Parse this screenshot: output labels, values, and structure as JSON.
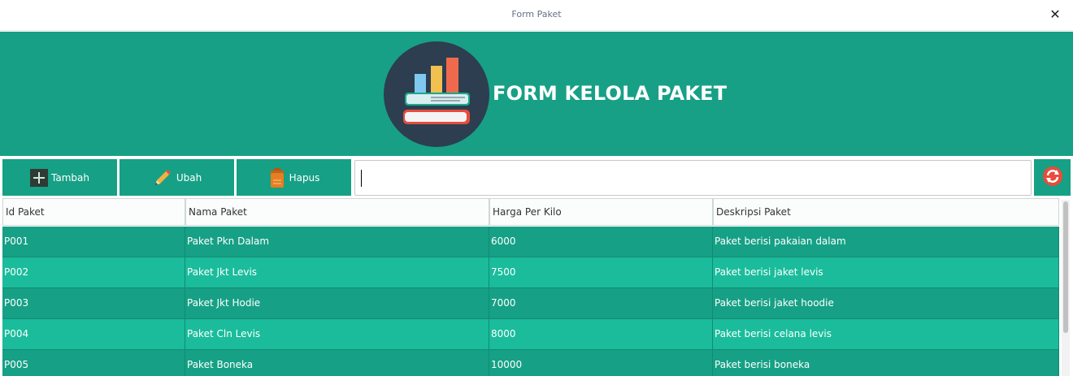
{
  "window": {
    "title": "Form Paket",
    "close_icon": "close-icon"
  },
  "banner": {
    "heading": "FORM KELOLA PAKET",
    "logo_icon": "books-chart-icon",
    "background": "#17a085"
  },
  "toolbar": {
    "tambah_label": "Tambah",
    "ubah_label": "Ubah",
    "hapus_label": "Hapus",
    "search_value": "",
    "search_placeholder": "",
    "tambah_icon": "plus-icon",
    "ubah_icon": "pencil-icon",
    "hapus_icon": "trash-icon",
    "refresh_icon": "refresh-icon"
  },
  "table": {
    "columns": [
      "Id Paket",
      "Nama Paket",
      "Harga Per Kilo",
      "Deskripsi Paket"
    ],
    "rows": [
      [
        "P001",
        "Paket Pkn Dalam",
        "6000",
        "Paket berisi pakaian dalam"
      ],
      [
        "P002",
        "Paket Jkt Levis",
        "7500",
        "Paket berisi jaket levis"
      ],
      [
        "P003",
        "Paket Jkt Hodie",
        "7000",
        "Paket berisi jaket hoodie"
      ],
      [
        "P004",
        "Paket Cln Levis",
        "8000",
        "Paket berisi celana levis"
      ],
      [
        "P005",
        "Paket Boneka",
        "10000",
        "Paket berisi boneka"
      ]
    ]
  },
  "colors": {
    "primary": "#16a085",
    "row_alt": "#1abc9c",
    "accent_red": "#e74c3c"
  }
}
